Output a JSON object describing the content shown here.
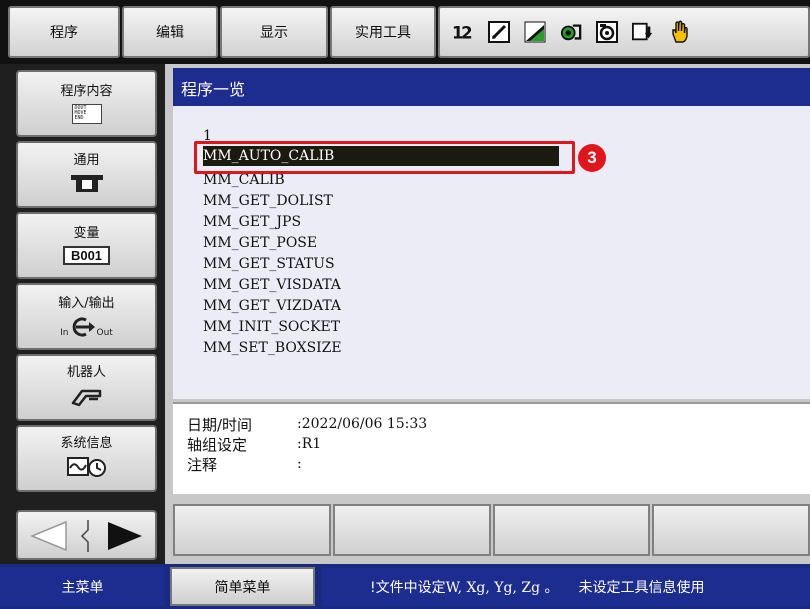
{
  "menu": {
    "program": "程序",
    "edit": "编辑",
    "display": "显示",
    "utility": "实用工具"
  },
  "toolbar_icons": [
    "numbering-icon",
    "edit-icon",
    "signal-icon",
    "mode-icon",
    "camera-icon",
    "save-icon",
    "hand-icon"
  ],
  "sidebar": {
    "items": [
      {
        "label": "程序内容",
        "icon": "program-content-icon",
        "doc_lines": [
          "DOUT",
          "MOVE",
          "END"
        ]
      },
      {
        "label": "通用",
        "icon": "general-icon"
      },
      {
        "label": "变量",
        "icon": "variable-icon",
        "badge": "B001"
      },
      {
        "label": "输入/输出",
        "icon": "io-icon",
        "in": "In",
        "out": "Out"
      },
      {
        "label": "机器人",
        "icon": "robot-icon"
      },
      {
        "label": "系统信息",
        "icon": "system-info-icon"
      }
    ]
  },
  "main": {
    "title": "程序一览",
    "programs": [
      "1",
      "MM_AUTO_CALIB",
      "MM_CALIB",
      "MM_GET_DOLIST",
      "MM_GET_JPS",
      "MM_GET_POSE",
      "MM_GET_STATUS",
      "MM_GET_VISDATA",
      "MM_GET_VIZDATA",
      "MM_INIT_SOCKET",
      "MM_SET_BOXSIZE"
    ],
    "selected_index": 1,
    "marker": "3",
    "info": {
      "date_label": "日期/时间",
      "date_value": ":2022/06/06 15:33",
      "group_label": "轴组设定",
      "group_value": ":R1",
      "comment_label": "注释",
      "comment_value": ":"
    }
  },
  "bottom": {
    "main_menu": "主菜单",
    "simple_menu": "简单菜单",
    "status_prefix": "!文件中设定",
    "status_mid": "W, Xg, Yg, Zg 。",
    "status_suffix": "未设定工具信息使用"
  },
  "colors": {
    "title_blue": "#1d2c8f",
    "highlight_red": "#e0161b",
    "list_bg": "#ececf6"
  }
}
